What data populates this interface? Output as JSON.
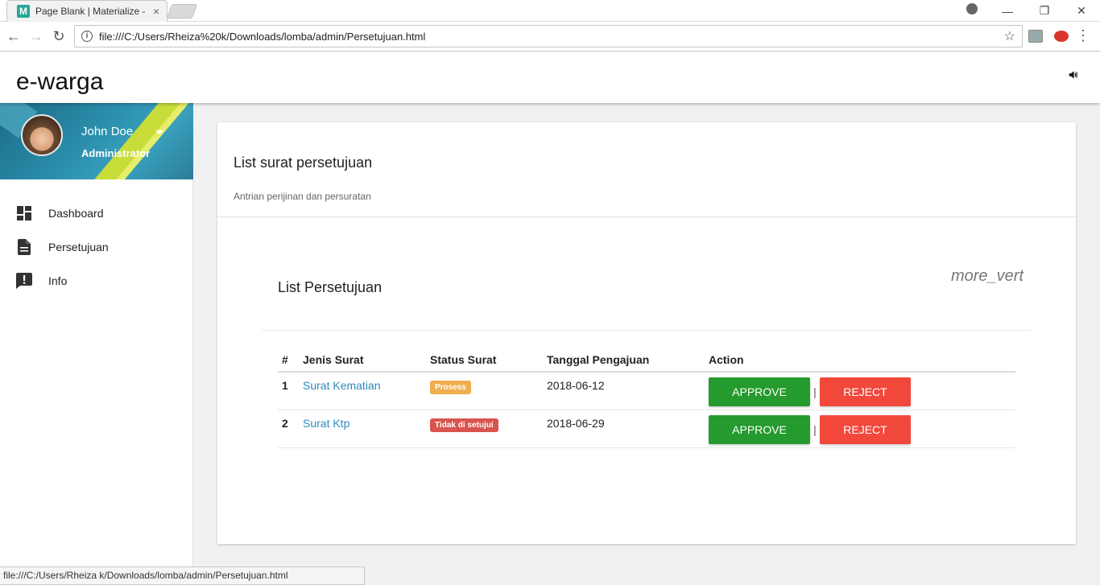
{
  "browser": {
    "tab_title": "Page Blank | Materialize -",
    "favicon_letter": "M",
    "tab_close": "×",
    "url": "file:///C:/Users/Rheiza%20k/Downloads/lomba/admin/Persetujuan.html",
    "status_url": "file:///C:/Users/Rheiza k/Downloads/lomba/admin/Persetujuan.html",
    "back": "←",
    "forward": "→",
    "reload": "↻",
    "info": "i",
    "bookmark": "☆",
    "menu": "⋮",
    "minimize": "—",
    "restore": "❐",
    "close": "✕"
  },
  "app": {
    "brand": "e-warga",
    "announce_icon": "campaign-icon"
  },
  "user": {
    "name": "John Doe",
    "role": "Administrator"
  },
  "sidebar": {
    "items": [
      {
        "label": "Dashboard",
        "icon": "dashboard-icon"
      },
      {
        "label": "Persetujuan",
        "icon": "description-icon"
      },
      {
        "label": "Info",
        "icon": "feedback-icon"
      }
    ]
  },
  "card": {
    "title": "List surat persetujuan",
    "subtitle": "Antrian perijinan dan persuratan"
  },
  "list": {
    "title": "List Persetujuan",
    "more": "more_vert",
    "headers": [
      "#",
      "Jenis Surat",
      "Status Surat",
      "Tanggal Pengajuan",
      "Action"
    ],
    "rows": [
      {
        "num": "1",
        "jenis": "Surat Kematian",
        "status": "Prosess",
        "status_color": "#f0ad4e",
        "tanggal": "2018-06-12",
        "approve": "APPROVE",
        "sep": "|",
        "reject": "REJECT"
      },
      {
        "num": "2",
        "jenis": "Surat Ktp",
        "status": "Tidak di setujui",
        "status_color": "#d9534f",
        "tanggal": "2018-06-29",
        "approve": "APPROVE",
        "sep": "|",
        "reject": "REJECT"
      }
    ]
  }
}
